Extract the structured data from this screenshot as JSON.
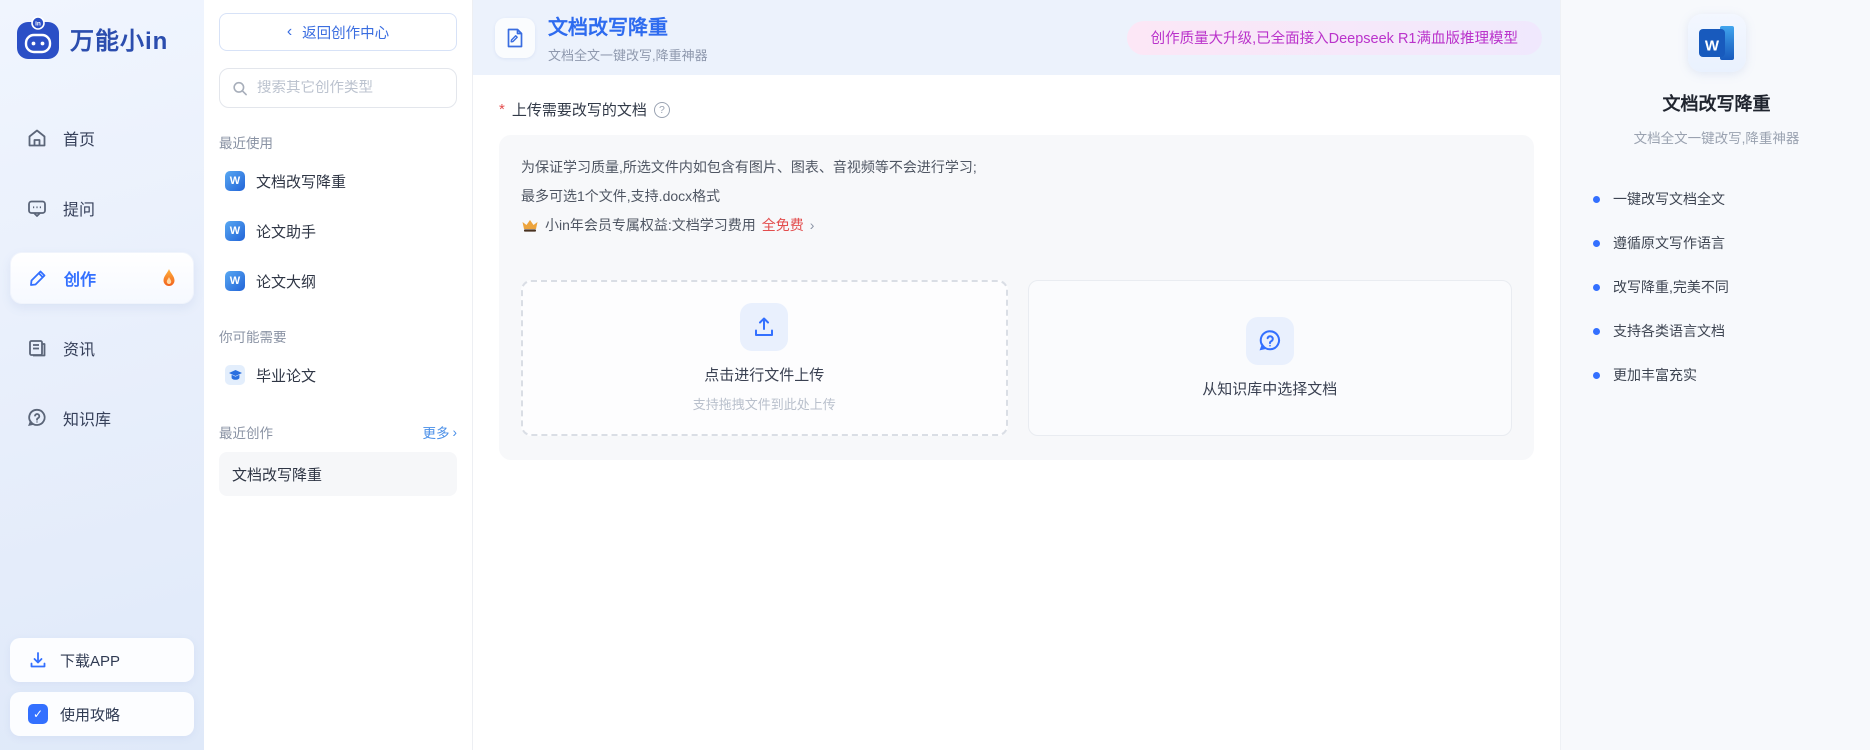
{
  "brand": {
    "name": "万能小in",
    "head_badge": "in"
  },
  "nav": {
    "items": [
      {
        "label": "首页",
        "icon": "home"
      },
      {
        "label": "提问",
        "icon": "chat"
      },
      {
        "label": "创作",
        "icon": "pen",
        "active": true,
        "flame": true
      },
      {
        "label": "资讯",
        "icon": "news"
      },
      {
        "label": "知识库",
        "icon": "knowledge"
      }
    ],
    "bottom": [
      {
        "label": "下载APP",
        "icon": "download"
      },
      {
        "label": "使用攻略",
        "icon": "guide-check"
      }
    ]
  },
  "sidebar": {
    "back_label": "返回创作中心",
    "back_chevron": "‹",
    "search_placeholder": "搜索其它创作类型",
    "sections": [
      {
        "title": "最近使用",
        "items": [
          {
            "label": "文档改写降重",
            "icon": "word"
          },
          {
            "label": "论文助手",
            "icon": "word"
          },
          {
            "label": "论文大纲",
            "icon": "word"
          }
        ]
      },
      {
        "title": "你可能需要",
        "items": [
          {
            "label": "毕业论文",
            "icon": "graduation-cap"
          }
        ]
      }
    ],
    "recent": {
      "title": "最近创作",
      "more_label": "更多",
      "more_chevron": "›",
      "items": [
        {
          "label": "文档改写降重",
          "active": true
        }
      ]
    }
  },
  "main": {
    "header": {
      "title": "文档改写降重",
      "subtitle": "文档全文一键改写,降重神器",
      "badge": "创作质量大升级,已全面接入Deepseek R1满血版推理模型"
    },
    "form": {
      "required_mark": "*",
      "label": "上传需要改写的文档",
      "help_glyph": "?",
      "notice_lines": [
        "为保证学习质量,所选文件内如包含有图片、图表、音视频等不会进行学习;",
        "最多可选1个文件,支持.docx格式"
      ],
      "vip": {
        "prefix": "小in年会员专属权益:文档学习费用",
        "highlight": "全免费",
        "chevron": "›"
      },
      "upload_box": {
        "title": "点击进行文件上传",
        "hint": "支持拖拽文件到此处上传"
      },
      "kb_box": {
        "title": "从知识库中选择文档"
      }
    }
  },
  "right_panel": {
    "icon_letter": "W",
    "title": "文档改写降重",
    "subtitle": "文档全文一键改写,降重神器",
    "features": [
      "一键改写文档全文",
      "遵循原文写作语言",
      "改写降重,完美不同",
      "支持各类语言文档",
      "更加丰富充实"
    ]
  },
  "colors": {
    "accent_blue": "#3370ff",
    "brand_blue": "#2b4dae",
    "badge_text": "#ba33cb",
    "free_red": "#e34d4d",
    "header_band": "#ecf2fc",
    "panel_gray": "#f7f8fa"
  }
}
